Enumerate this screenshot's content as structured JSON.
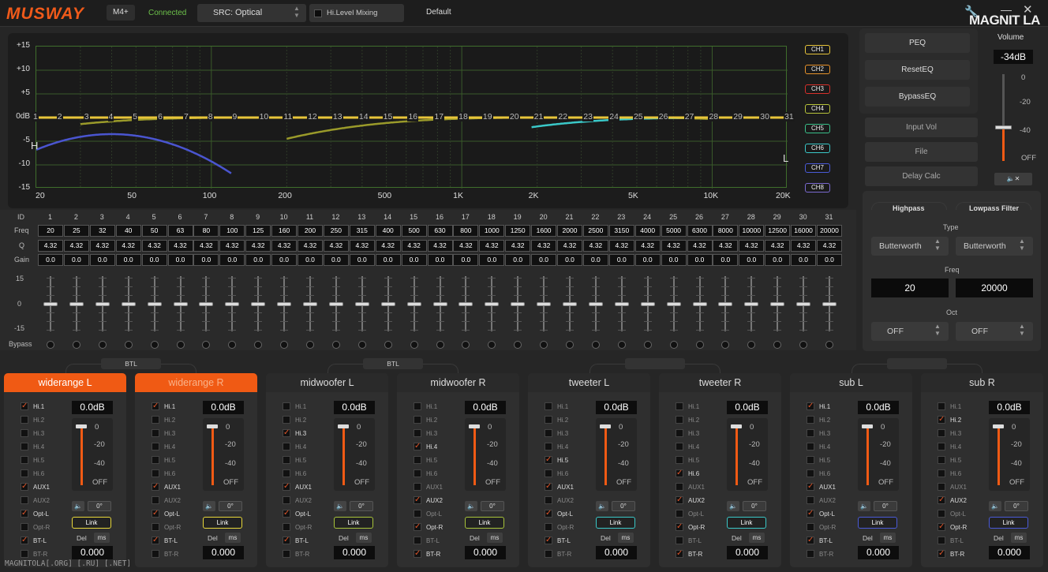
{
  "app": {
    "logo": "MUSWAY",
    "model": "M4+",
    "status": "Connected",
    "src_label": "SRC:",
    "src_value": "Optical",
    "hilevel": "Hi.Level Mixing",
    "preset": "Default",
    "watermark": "MAGNIT LA",
    "footer": "MAGNITOLA[.ORG] [.RU] [.NET]",
    "colors": {
      "accent": "#f05a14",
      "status": "#6cc04a"
    }
  },
  "graph": {
    "yticks": [
      "+15",
      "+10",
      "+5",
      "0dB",
      "-5",
      "-10",
      "-15"
    ],
    "xticks": [
      "20",
      "50",
      "100",
      "200",
      "500",
      "1K",
      "2K",
      "5K",
      "10K",
      "20K"
    ],
    "band_numbers": [
      "1",
      "2",
      "3",
      "4",
      "5",
      "6",
      "7",
      "8",
      "9",
      "10",
      "11",
      "12",
      "13",
      "14",
      "15",
      "16",
      "17",
      "18",
      "19",
      "20",
      "21",
      "22",
      "23",
      "24",
      "25",
      "26",
      "27",
      "28",
      "29",
      "30",
      "31"
    ],
    "h_label": "H",
    "l_label": "L",
    "channels": [
      {
        "label": "CH1",
        "color": "#e8c53a"
      },
      {
        "label": "CH2",
        "color": "#e8932a"
      },
      {
        "label": "CH3",
        "color": "#d8302a"
      },
      {
        "label": "CH4",
        "color": "#b8c43a"
      },
      {
        "label": "CH5",
        "color": "#3ac08a"
      },
      {
        "label": "CH6",
        "color": "#3ac8c8"
      },
      {
        "label": "CH7",
        "color": "#4a5ad8"
      },
      {
        "label": "CH8",
        "color": "#7a6ad0"
      }
    ]
  },
  "right": {
    "buttons": [
      "PEQ",
      "ResetEQ",
      "BypassEQ"
    ],
    "buttons2": [
      "Input Vol",
      "File",
      "Delay Calc"
    ],
    "volume_label": "Volume",
    "volume_value": "-34dB",
    "volume_scale": [
      "0",
      "-20",
      "-40",
      "OFF"
    ],
    "volume_level_db": -34
  },
  "filter": {
    "highpass": "Highpass",
    "lowpass": "Lowpass Filter",
    "type_label": "Type",
    "hp_type": "Butterworth",
    "lp_type": "Butterworth",
    "freq_label": "Freq",
    "hp_freq": "20",
    "lp_freq": "20000",
    "oct_label": "Oct",
    "hp_oct": "OFF",
    "lp_oct": "OFF"
  },
  "eq": {
    "labels": {
      "id": "ID",
      "freq": "Freq",
      "q": "Q",
      "gain": "Gain",
      "bypass": "Bypass"
    },
    "scale": [
      "15",
      "0",
      "-15"
    ],
    "ids": [
      "1",
      "2",
      "3",
      "4",
      "5",
      "6",
      "7",
      "8",
      "9",
      "10",
      "11",
      "12",
      "13",
      "14",
      "15",
      "16",
      "17",
      "18",
      "19",
      "20",
      "21",
      "22",
      "23",
      "24",
      "25",
      "26",
      "27",
      "28",
      "29",
      "30",
      "31"
    ],
    "freqs": [
      "20",
      "25",
      "32",
      "40",
      "50",
      "63",
      "80",
      "100",
      "125",
      "160",
      "200",
      "250",
      "315",
      "400",
      "500",
      "630",
      "800",
      "1000",
      "1250",
      "1600",
      "2000",
      "2500",
      "3150",
      "4000",
      "5000",
      "6300",
      "8000",
      "10000",
      "12500",
      "16000",
      "20000"
    ],
    "q": [
      "4.32",
      "4.32",
      "4.32",
      "4.32",
      "4.32",
      "4.32",
      "4.32",
      "4.32",
      "4.32",
      "4.32",
      "4.32",
      "4.32",
      "4.32",
      "4.32",
      "4.32",
      "4.32",
      "4.32",
      "4.32",
      "4.32",
      "4.32",
      "4.32",
      "4.32",
      "4.32",
      "4.32",
      "4.32",
      "4.32",
      "4.32",
      "4.32",
      "4.32",
      "4.32",
      "4.32"
    ],
    "gain": [
      "0.0",
      "0.0",
      "0.0",
      "0.0",
      "0.0",
      "0.0",
      "0.0",
      "0.0",
      "0.0",
      "0.0",
      "0.0",
      "0.0",
      "0.0",
      "0.0",
      "0.0",
      "0.0",
      "0.0",
      "0.0",
      "0.0",
      "0.0",
      "0.0",
      "0.0",
      "0.0",
      "0.0",
      "0.0",
      "0.0",
      "0.0",
      "0.0",
      "0.0",
      "0.0",
      "0.0"
    ]
  },
  "links": [
    "BTL",
    "BTL",
    "",
    ""
  ],
  "input_names": [
    "Hi.1",
    "Hi.2",
    "Hi.3",
    "Hi.4",
    "Hi.5",
    "Hi.6",
    "AUX1",
    "AUX2",
    "Opt-L",
    "Opt-R",
    "BT-L",
    "BT-R"
  ],
  "channels": [
    {
      "name": "widerange L",
      "state": "on",
      "db": "0.0dB",
      "checks": [
        1,
        0,
        0,
        0,
        0,
        0,
        1,
        0,
        1,
        0,
        1,
        0
      ],
      "link_color": "#e8d83a",
      "delay": "0.000"
    },
    {
      "name": "widerange R",
      "state": "dim",
      "db": "0.0dB",
      "checks": [
        1,
        0,
        0,
        0,
        0,
        0,
        1,
        0,
        1,
        0,
        1,
        0
      ],
      "link_color": "#e8d83a",
      "delay": "0.000"
    },
    {
      "name": "midwoofer L",
      "state": "off",
      "db": "0.0dB",
      "checks": [
        0,
        0,
        1,
        0,
        0,
        0,
        1,
        0,
        1,
        0,
        1,
        0
      ],
      "link_color": "#a8c43a",
      "delay": "0.000"
    },
    {
      "name": "midwoofer R",
      "state": "off",
      "db": "0.0dB",
      "checks": [
        0,
        0,
        0,
        1,
        0,
        0,
        0,
        1,
        0,
        1,
        0,
        1
      ],
      "link_color": "#a8c43a",
      "delay": "0.000"
    },
    {
      "name": "tweeter L",
      "state": "off",
      "db": "0.0dB",
      "checks": [
        0,
        0,
        0,
        0,
        1,
        0,
        1,
        0,
        1,
        0,
        1,
        0
      ],
      "link_color": "#3ac8c8",
      "delay": "0.000"
    },
    {
      "name": "tweeter R",
      "state": "off",
      "db": "0.0dB",
      "checks": [
        0,
        0,
        0,
        0,
        0,
        1,
        0,
        1,
        0,
        1,
        0,
        1
      ],
      "link_color": "#3ac8c8",
      "delay": "0.000"
    },
    {
      "name": "sub L",
      "state": "off",
      "db": "0.0dB",
      "checks": [
        1,
        0,
        0,
        0,
        0,
        0,
        1,
        0,
        1,
        0,
        1,
        0
      ],
      "link_color": "#4a5ad8",
      "delay": "0.000"
    },
    {
      "name": "sub R",
      "state": "off",
      "db": "0.0dB",
      "checks": [
        0,
        1,
        0,
        0,
        0,
        0,
        0,
        1,
        0,
        1,
        0,
        1
      ],
      "link_color": "#4a5ad8",
      "delay": "0.000"
    }
  ],
  "ch_common": {
    "scale": [
      "0",
      "-20",
      "-40",
      "OFF"
    ],
    "phase": "0°",
    "link": "Link",
    "del": "Del",
    "ms": "ms"
  }
}
